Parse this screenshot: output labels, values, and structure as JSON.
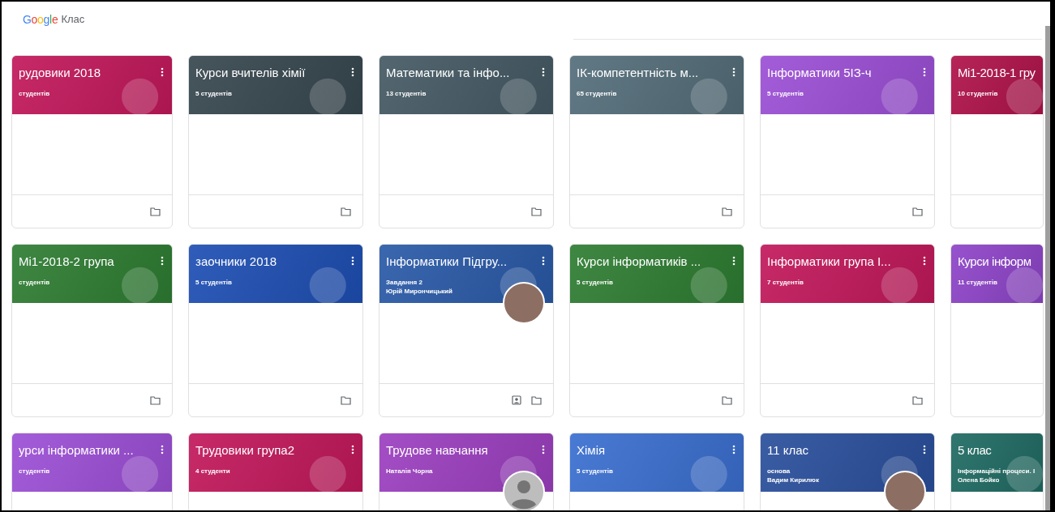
{
  "header": {
    "logo": "Google",
    "product": "Клас"
  },
  "rows": [
    [
      {
        "title": "рудовики 2018",
        "lines": [
          "студентів"
        ],
        "color": "#c2185b",
        "menu": true,
        "folder": true
      },
      {
        "title": "Курси вчителів хімії",
        "lines": [
          "5 студентів"
        ],
        "color": "#37474f",
        "menu": true,
        "folder": true
      },
      {
        "title": "Математики та інфо...",
        "lines": [
          "13 студентів"
        ],
        "color": "#455a64",
        "menu": true,
        "folder": true
      },
      {
        "title": "ІК-компетентність м...",
        "lines": [
          "65 студентів"
        ],
        "color": "#546e7a",
        "menu": true,
        "folder": true
      },
      {
        "title": "Інформатики 5ІЗ-ч",
        "lines": [
          "5 студентів"
        ],
        "color": "#9c4fd6",
        "menu": true,
        "folder": true
      },
      {
        "title": "Мі1-2018-1 гру",
        "lines": [
          "10 студентів"
        ],
        "color": "#b0124a"
      }
    ],
    [
      {
        "title": "Мі1-2018-2 група",
        "lines": [
          "студентів"
        ],
        "color": "#2e7d32",
        "menu": true,
        "folder": true
      },
      {
        "title": "заочники 2018",
        "lines": [
          "5 студентів"
        ],
        "color": "#1e4fb4",
        "menu": true,
        "folder": true
      },
      {
        "title": "Інформатики Підгру...",
        "lines": [
          "Завдання 2",
          "Юрій Мирончицький"
        ],
        "color": "#2a5aa8",
        "menu": true,
        "photo_avatar": true,
        "assignments": true,
        "folder": true
      },
      {
        "title": "Курси інформатиків ...",
        "lines": [
          "5 студентів"
        ],
        "color": "#2e7d32",
        "menu": true,
        "folder": true
      },
      {
        "title": "Інформатики група І...",
        "lines": [
          "7 студентів"
        ],
        "color": "#c2185b",
        "menu": true,
        "folder": true
      },
      {
        "title": "Курси інформ",
        "lines": [
          "11 студентів"
        ],
        "color": "#8e44c9"
      }
    ],
    [
      {
        "title": "урси інформатики ...",
        "lines": [
          "студентів"
        ],
        "color": "#9c4fd6",
        "menu": true
      },
      {
        "title": "Трудовики група2",
        "lines": [
          "4 студенти"
        ],
        "color": "#c2185b",
        "menu": true
      },
      {
        "title": "Трудове навчання",
        "lines": [
          "Наталія Чорна"
        ],
        "color": "#9c3fc0",
        "menu": true,
        "default_avatar": true
      },
      {
        "title": "Хімія",
        "lines": [
          "5 студентів"
        ],
        "color": "#3a6fd0",
        "menu": true
      },
      {
        "title": "11 клас",
        "lines": [
          "основа",
          "Вадим Кирилюк"
        ],
        "color": "#2a4f9c",
        "menu": true,
        "photo_avatar": true
      },
      {
        "title": "5 клас",
        "lines": [
          "Інформаційні процеси. І",
          "Олена Бойко"
        ],
        "color": "#1f6b63"
      }
    ]
  ]
}
